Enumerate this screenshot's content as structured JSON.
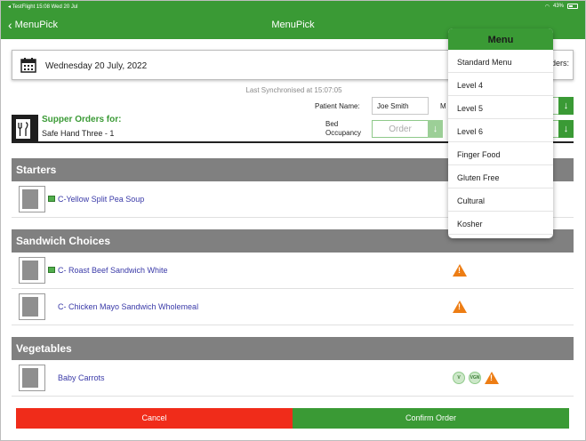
{
  "status_bar": {
    "left": "◂ TestFlight  15:08  Wed 20 Jul",
    "battery": "43%"
  },
  "nav": {
    "back_label": "MenuPick",
    "title": "MenuPick"
  },
  "date_box": {
    "date": "Wednesday 20 July, 2022",
    "orders_label": "ders:"
  },
  "sync": "Last Synchronised at 15:07:05",
  "patient": {
    "label": "Patient Name:",
    "value": "Joe Smith",
    "m_label": "M"
  },
  "supper": {
    "title": "Supper Orders for:",
    "subtitle": "Safe Hand Three - 1",
    "bed_label_1": "Bed",
    "bed_label_2": "Occupancy",
    "order_placeholder": "Order"
  },
  "sections": {
    "starters": "Starters",
    "sandwich": "Sandwich Choices",
    "vegetables": "Vegetables"
  },
  "items": {
    "soup": "C-Yellow Split Pea Soup",
    "beef": "C- Roast Beef Sandwich White",
    "chicken": "C- Chicken Mayo Sandwich Wholemeal",
    "carrots": "Baby Carrots"
  },
  "badges": {
    "v": "V",
    "vgn": "VGN"
  },
  "buttons": {
    "cancel": "Cancel",
    "confirm": "Confirm Order"
  },
  "menu": {
    "title": "Menu",
    "options": [
      "Standard Menu",
      "Level 4",
      "Level 5",
      "Level 6",
      "Finger Food",
      "Gluten Free",
      "Cultural",
      "Kosher"
    ]
  },
  "colors": {
    "brand_green": "#3a9a35",
    "cancel_red": "#f02c1a",
    "warning_orange": "#ed7d14",
    "section_gray": "#808080"
  }
}
